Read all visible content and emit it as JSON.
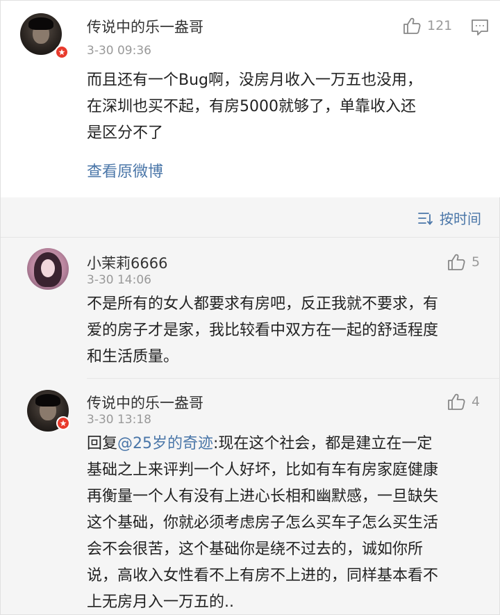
{
  "main_post": {
    "username": "传说中的乐一盎哥",
    "timestamp": "3-30 09:36",
    "like_count": "121",
    "text_lines": [
      "而且还有一个Bug啊，没房月收入一万五也没用，",
      "在深圳也买不起，有房5000就够了，单靠收入还",
      "是区分不了"
    ],
    "view_original_label": "查看原微博",
    "icons": {
      "like": "thumbs-up-icon",
      "comment": "comment-icon",
      "badge": "verified-badge-icon"
    }
  },
  "sort": {
    "label": "按时间",
    "icon": "sort-icon"
  },
  "comments": [
    {
      "username": "小茉莉6666",
      "timestamp": "3-30 14:06",
      "like_count": "5",
      "text_lines": [
        "不是所有的女人都要求有房吧，反正我就不要求，有",
        "爱的房子才是家，我比较看中双方在一起的舒适程度",
        "和生活质量。"
      ]
    },
    {
      "username": "传说中的乐一盎哥",
      "timestamp": "3-30 13:18",
      "like_count": "4",
      "reply_prefix": "回复",
      "mention": "@25岁的奇迹",
      "text_first_rest": ":现在这个社会，都是建立在一定",
      "text_lines": [
        "基础之上来评判一个人好坏，比如有车有房家庭健康",
        "再衡量一个人有没有上进心长相和幽默感，一旦缺失",
        "这个基础，你就必须考虑房子怎么买车子怎么买生活",
        "会不会很苦，这个基础你是绕不过去的，诚如你所",
        "说，高收入女性看不上有房不上进的，同样基本看不",
        "上无房月入一万五的.."
      ]
    }
  ],
  "colors": {
    "accent": "#4a76a8",
    "badge": "#e83a2c",
    "muted": "#999999"
  }
}
